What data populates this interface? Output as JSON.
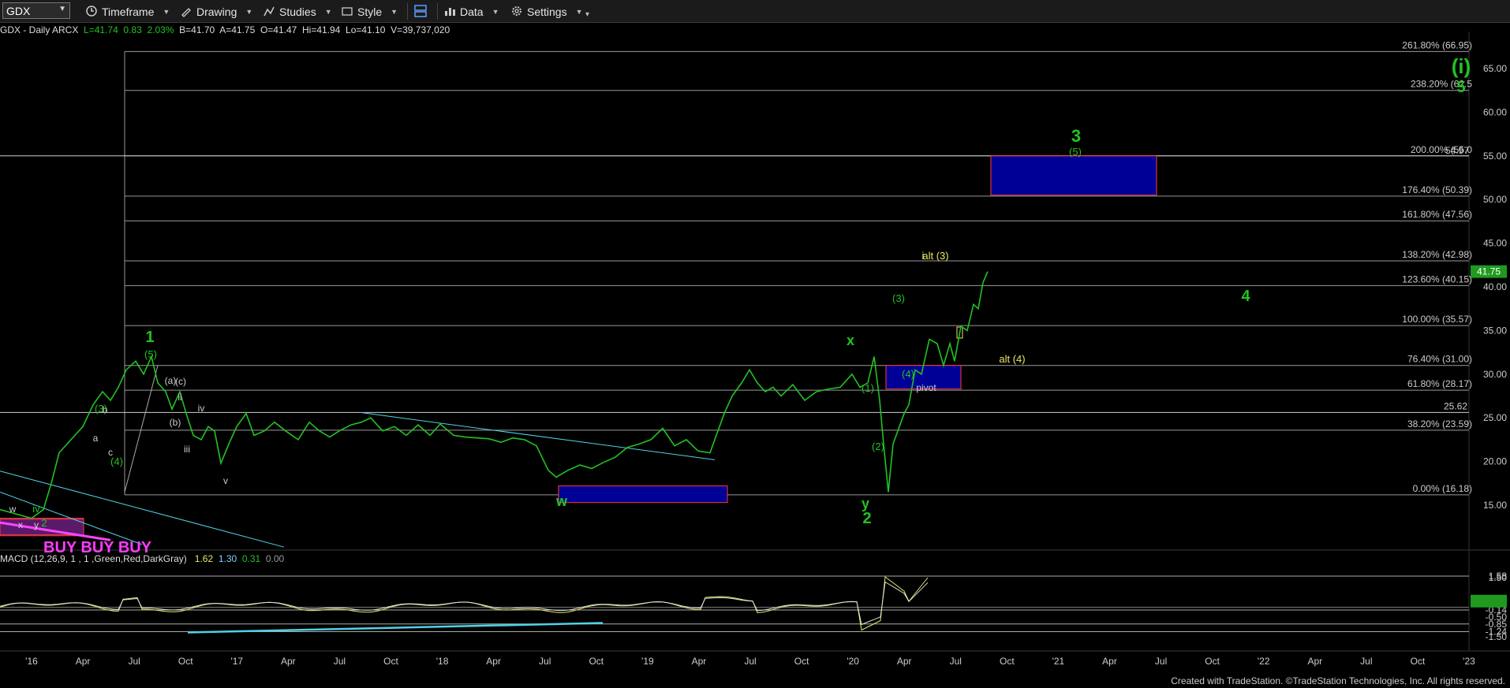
{
  "toolbar": {
    "symbol": "GDX",
    "timeframe": "Timeframe",
    "drawing": "Drawing",
    "studies": "Studies",
    "style": "Style",
    "data": "Data",
    "settings": "Settings"
  },
  "info": {
    "name": "GDX - Daily  ARCX",
    "last": "L=41.74",
    "chg": "0.83",
    "pct": "2.03%",
    "bid": "B=41.70",
    "ask": "A=41.75",
    "open": "O=41.47",
    "high": "Hi=41.94",
    "low": "Lo=41.10",
    "vol": "V=39,737,020"
  },
  "macd_info": {
    "name": "MACD (12,26,9, 1 , 1 ,Green,Red,DarkGray)",
    "v1": "1.62",
    "v2": "1.30",
    "v3": "0.31",
    "v4": "0.00"
  },
  "price_axis": [
    "65.00",
    "60.00",
    "55.00",
    "50.00",
    "45.00",
    "40.00",
    "35.00",
    "30.00",
    "25.00",
    "20.00",
    "15.00"
  ],
  "price_ticks": [
    65,
    60,
    55,
    50,
    45,
    40,
    35,
    30,
    25,
    20,
    15
  ],
  "macd_axis": [
    "1.58",
    "1.50",
    "0.31",
    "-0.14",
    "-0.50",
    "-0.85",
    "-1.24",
    "-1.50"
  ],
  "time_axis": [
    "'16",
    "Apr",
    "Jul",
    "Oct",
    "'17",
    "Apr",
    "Jul",
    "Oct",
    "'18",
    "Apr",
    "Jul",
    "Oct",
    "'19",
    "Apr",
    "Jul",
    "Oct",
    "'20",
    "Apr",
    "Jul",
    "Oct",
    "'21",
    "Apr",
    "Jul",
    "Oct",
    "'22",
    "Apr",
    "Jul",
    "Oct",
    "'23"
  ],
  "last_price": "41.75",
  "macd_last": "0.31",
  "fib_levels": [
    {
      "label": "261.80% (66.95)",
      "price": 66.95
    },
    {
      "label": "238.20% (62.5",
      "price": 62.5
    },
    {
      "label": "200.00% (55.0",
      "price": 55.0
    },
    {
      "label": "176.40% (50.39)",
      "price": 50.39
    },
    {
      "label": "161.80% (47.56)",
      "price": 47.56
    },
    {
      "label": "138.20% (42.98)",
      "price": 42.98
    },
    {
      "label": "123.60% (40.15)",
      "price": 40.15
    },
    {
      "label": "100.00% (35.57)",
      "price": 35.57
    },
    {
      "label": "76.40% (31.00)",
      "price": 31.0
    },
    {
      "label": "61.80% (28.17)",
      "price": 28.17
    },
    {
      "label": "38.20% (23.59)",
      "price": 23.59
    },
    {
      "label": "0.00% (16.18)",
      "price": 16.18
    }
  ],
  "hline_label": "25.62",
  "hline_label2": "54.97",
  "wave_labels": {
    "w1": "1",
    "w5a": "(5)",
    "w3": "(3)",
    "w4": "(4)",
    "a": "a",
    "b": "b",
    "c": "c",
    "ab": "(a)",
    "bb": "(b)",
    "cb": "(c)",
    "ii": "ii",
    "iii": "iii",
    "iv": "iv",
    "v": "v",
    "W": "w",
    "X": "x",
    "Y": "y",
    "two": "2",
    "p1": "(1)",
    "p2": "(2)",
    "p3": "(3)",
    "p4": "(4)",
    "i": "i",
    "alt3": "alt (3)",
    "alt4": "alt (4)",
    "pivot": "pivot",
    "big3": "3",
    "big3sub": "(5)",
    "big4": "4",
    "bigI": "(i)",
    "big5": "5",
    "buy": "BUY BUY BUY",
    "lw": "w",
    "lx": "x",
    "ly": "y",
    "liv": "iv",
    "lii": "2"
  },
  "footer": "Created with TradeStation. ©TradeStation Technologies, Inc. All rights reserved.",
  "colors": {
    "price": "#22c222",
    "box": "#00008c",
    "boxBorder": "#ff3b3b",
    "trend": "#4fd2e6"
  }
}
